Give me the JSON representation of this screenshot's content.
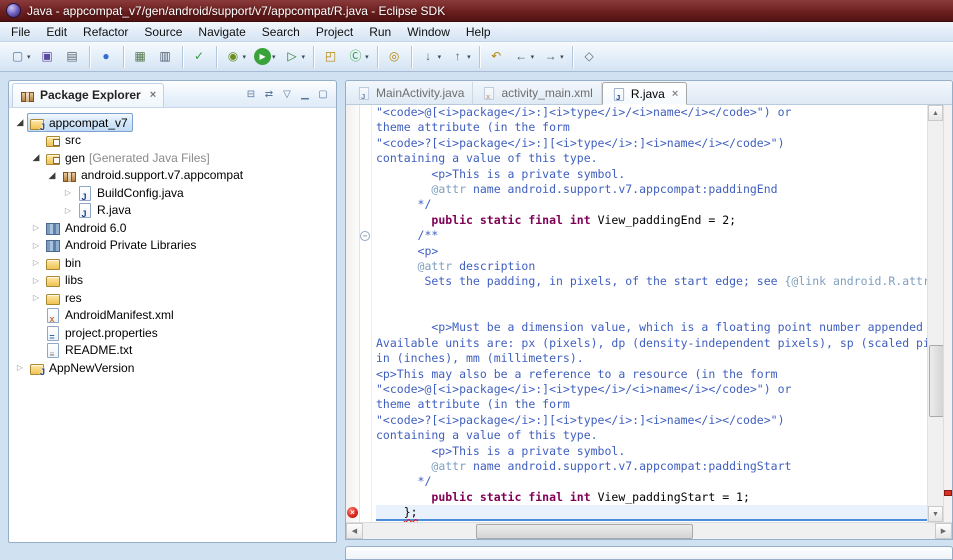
{
  "window": {
    "title": "Java - appcompat_v7/gen/android/support/v7/appcompat/R.java - Eclipse SDK"
  },
  "menu": {
    "items": [
      "File",
      "Edit",
      "Refactor",
      "Source",
      "Navigate",
      "Search",
      "Project",
      "Run",
      "Window",
      "Help"
    ]
  },
  "glyphs": {
    "dropdown": "▾",
    "close": "×",
    "scroll_up": "▲",
    "scroll_down": "▼",
    "scroll_left": "◀",
    "scroll_right": "▶",
    "expanded": "◢",
    "collapsed": "▷",
    "fold_collapse": "−"
  },
  "colors": {
    "comment": "#3f5fbf",
    "doc_tag": "#7f9fbf",
    "keyword": "#7f0055",
    "plain": "#000000",
    "line_highlight": "#e9f2fc",
    "selection_blue": "#4a8ddc"
  },
  "toolbar": {
    "groups": [
      [
        {
          "name": "new-wizard",
          "glyph": "▢",
          "color": "#5b7aa6",
          "dropdown": true
        },
        {
          "name": "save",
          "glyph": "▣",
          "color": "#5b4a9e"
        },
        {
          "name": "print",
          "glyph": "▤",
          "color": "#5a6570"
        }
      ],
      [
        {
          "name": "globe",
          "glyph": "●",
          "color": "#2e6fd0"
        }
      ],
      [
        {
          "name": "android-sdk-manager",
          "glyph": "▦",
          "color": "#55784a"
        },
        {
          "name": "android-virtual-device-manager",
          "glyph": "▥",
          "color": "#4a5a6a"
        }
      ],
      [
        {
          "name": "lint-check",
          "glyph": "✓",
          "color": "#2f9e44"
        }
      ],
      [
        {
          "name": "debug",
          "glyph": "◉",
          "color": "#6b8e23",
          "dropdown": true
        },
        {
          "name": "run",
          "glyph": "▶",
          "color": "#ffffff",
          "bg": "#3aa23a",
          "dropdown": true
        },
        {
          "name": "external-tools",
          "glyph": "▷",
          "color": "#2f7a2f",
          "dropdown": true
        }
      ],
      [
        {
          "name": "new-java-project",
          "glyph": "◰",
          "color": "#b8860b"
        },
        {
          "name": "new-java-class",
          "glyph": "Ⓒ",
          "color": "#2f9e44",
          "dropdown": true
        }
      ],
      [
        {
          "name": "search",
          "glyph": "◎",
          "color": "#b8860b"
        }
      ],
      [
        {
          "name": "next-annotation",
          "glyph": "↓",
          "color": "#5a6a7a",
          "dropdown": true
        },
        {
          "name": "previous-annotation",
          "glyph": "↑",
          "color": "#5a6a7a",
          "dropdown": true
        }
      ],
      [
        {
          "name": "last-edit-location",
          "glyph": "↶",
          "color": "#b8860b"
        },
        {
          "name": "back",
          "glyph": "←",
          "color": "#46586a",
          "dropdown": true
        },
        {
          "name": "forward",
          "glyph": "→",
          "color": "#46586a",
          "dropdown": true
        }
      ],
      [
        {
          "name": "pin-editor",
          "glyph": "◇",
          "color": "#5a6a7a"
        }
      ]
    ]
  },
  "package_explorer": {
    "title": "Package Explorer",
    "header_icons": [
      {
        "name": "collapse-all",
        "glyph": "⊟"
      },
      {
        "name": "link-with-editor",
        "glyph": "⇄"
      },
      {
        "name": "view-menu",
        "glyph": "▽"
      },
      {
        "name": "minimize",
        "glyph": "▁"
      },
      {
        "name": "maximize",
        "glyph": "▢"
      }
    ],
    "tree": [
      {
        "label": "appcompat_v7",
        "level": 0,
        "expand": "expanded",
        "icon": "java-project",
        "selected": true
      },
      {
        "label": "src",
        "level": 1,
        "expand": "none",
        "icon": "src-folder"
      },
      {
        "label": "gen",
        "decoration": " [Generated Java Files]",
        "level": 1,
        "expand": "expanded",
        "icon": "src-folder"
      },
      {
        "label": "android.support.v7.appcompat",
        "level": 2,
        "expand": "expanded",
        "icon": "package"
      },
      {
        "label": "BuildConfig.java",
        "level": 3,
        "expand": "collapsed",
        "icon": "java-file"
      },
      {
        "label": "R.java",
        "level": 3,
        "expand": "collapsed",
        "icon": "java-file"
      },
      {
        "label": "Android 6.0",
        "level": 1,
        "expand": "collapsed",
        "icon": "library"
      },
      {
        "label": "Android Private Libraries",
        "level": 1,
        "expand": "collapsed",
        "icon": "library"
      },
      {
        "label": "bin",
        "level": 1,
        "expand": "collapsed",
        "icon": "folder"
      },
      {
        "label": "libs",
        "level": 1,
        "expand": "collapsed",
        "icon": "folder"
      },
      {
        "label": "res",
        "level": 1,
        "expand": "collapsed",
        "icon": "folder"
      },
      {
        "label": "AndroidManifest.xml",
        "level": 1,
        "expand": "none",
        "icon": "xml-file"
      },
      {
        "label": "project.properties",
        "level": 1,
        "expand": "none",
        "icon": "properties-file"
      },
      {
        "label": "README.txt",
        "level": 1,
        "expand": "none",
        "icon": "text-file"
      },
      {
        "label": "AppNewVersion",
        "level": 0,
        "expand": "collapsed",
        "icon": "java-project"
      }
    ]
  },
  "editor": {
    "tabs": [
      {
        "label": "MainActivity.java",
        "icon": "java-file",
        "active": false
      },
      {
        "label": "activity_main.xml",
        "icon": "xml-file",
        "active": false
      },
      {
        "label": "R.java",
        "icon": "java-file",
        "active": true,
        "closable": true
      }
    ],
    "lines": [
      {
        "segments": [
          [
            "c",
            "\"<code>@[<i>package</i>:]<i>type</i>/<i>name</i></code>\") or"
          ]
        ]
      },
      {
        "segments": [
          [
            "c",
            "theme attribute (in the form"
          ]
        ]
      },
      {
        "segments": [
          [
            "c",
            "\"<code>?[<i>package</i>:][<i>type</i>:]<i>name</i></code>\")"
          ]
        ]
      },
      {
        "segments": [
          [
            "c",
            "containing a value of this type."
          ]
        ]
      },
      {
        "segments": [
          [
            "c",
            "        <p>This is a private symbol."
          ]
        ]
      },
      {
        "segments": [
          [
            "c",
            "        "
          ],
          [
            "t",
            "@attr"
          ],
          [
            "c",
            " name android.support.v7.appcompat:paddingEnd"
          ]
        ]
      },
      {
        "segments": [
          [
            "c",
            "      */"
          ]
        ]
      },
      {
        "segments": [
          [
            "p",
            "        "
          ],
          [
            "k",
            "public static final int"
          ],
          [
            "p",
            " View_paddingEnd = 2;"
          ]
        ]
      },
      {
        "segments": [
          [
            "c",
            "      /**"
          ]
        ],
        "fold": "collapse"
      },
      {
        "segments": [
          [
            "c",
            "      <p>"
          ]
        ]
      },
      {
        "segments": [
          [
            "c",
            "      "
          ],
          [
            "t",
            "@attr"
          ],
          [
            "c",
            " description"
          ]
        ]
      },
      {
        "segments": [
          [
            "c",
            "       Sets the padding, in pixels, of the start edge; see "
          ],
          [
            "t",
            "{@link android.R.attr#paddingStart}"
          ],
          [
            "c",
            "."
          ]
        ]
      },
      {
        "segments": []
      },
      {
        "segments": []
      },
      {
        "segments": [
          [
            "c",
            "        <p>Must be a dimension value, which is a floating point number appended with a unit such as \"<code>14.5sp</code>\"."
          ]
        ]
      },
      {
        "segments": [
          [
            "c",
            "Available units are: px (pixels), dp (density-independent pixels), sp (scaled pixels based on preferred font size),"
          ]
        ]
      },
      {
        "segments": [
          [
            "c",
            "in (inches), mm (millimeters)."
          ]
        ]
      },
      {
        "segments": [
          [
            "c",
            "<p>This may also be a reference to a resource (in the form"
          ]
        ]
      },
      {
        "segments": [
          [
            "c",
            "\"<code>@[<i>package</i>:]<i>type</i>/<i>name</i></code>\") or"
          ]
        ]
      },
      {
        "segments": [
          [
            "c",
            "theme attribute (in the form"
          ]
        ]
      },
      {
        "segments": [
          [
            "c",
            "\"<code>?[<i>package</i>:][<i>type</i>:]<i>name</i></code>\")"
          ]
        ]
      },
      {
        "segments": [
          [
            "c",
            "containing a value of this type."
          ]
        ]
      },
      {
        "segments": [
          [
            "c",
            "        <p>This is a private symbol."
          ]
        ]
      },
      {
        "segments": [
          [
            "c",
            "        "
          ],
          [
            "t",
            "@attr"
          ],
          [
            "c",
            " name android.support.v7.appcompat:paddingStart"
          ]
        ]
      },
      {
        "segments": [
          [
            "c",
            "      */"
          ]
        ]
      },
      {
        "segments": [
          [
            "p",
            "        "
          ],
          [
            "k",
            "public static final int"
          ],
          [
            "p",
            " View_paddingStart = 1;"
          ]
        ]
      },
      {
        "segments": [
          [
            "p",
            "    "
          ],
          [
            "e",
            "};"
          ]
        ],
        "highlight": true,
        "marker": "error"
      }
    ]
  }
}
